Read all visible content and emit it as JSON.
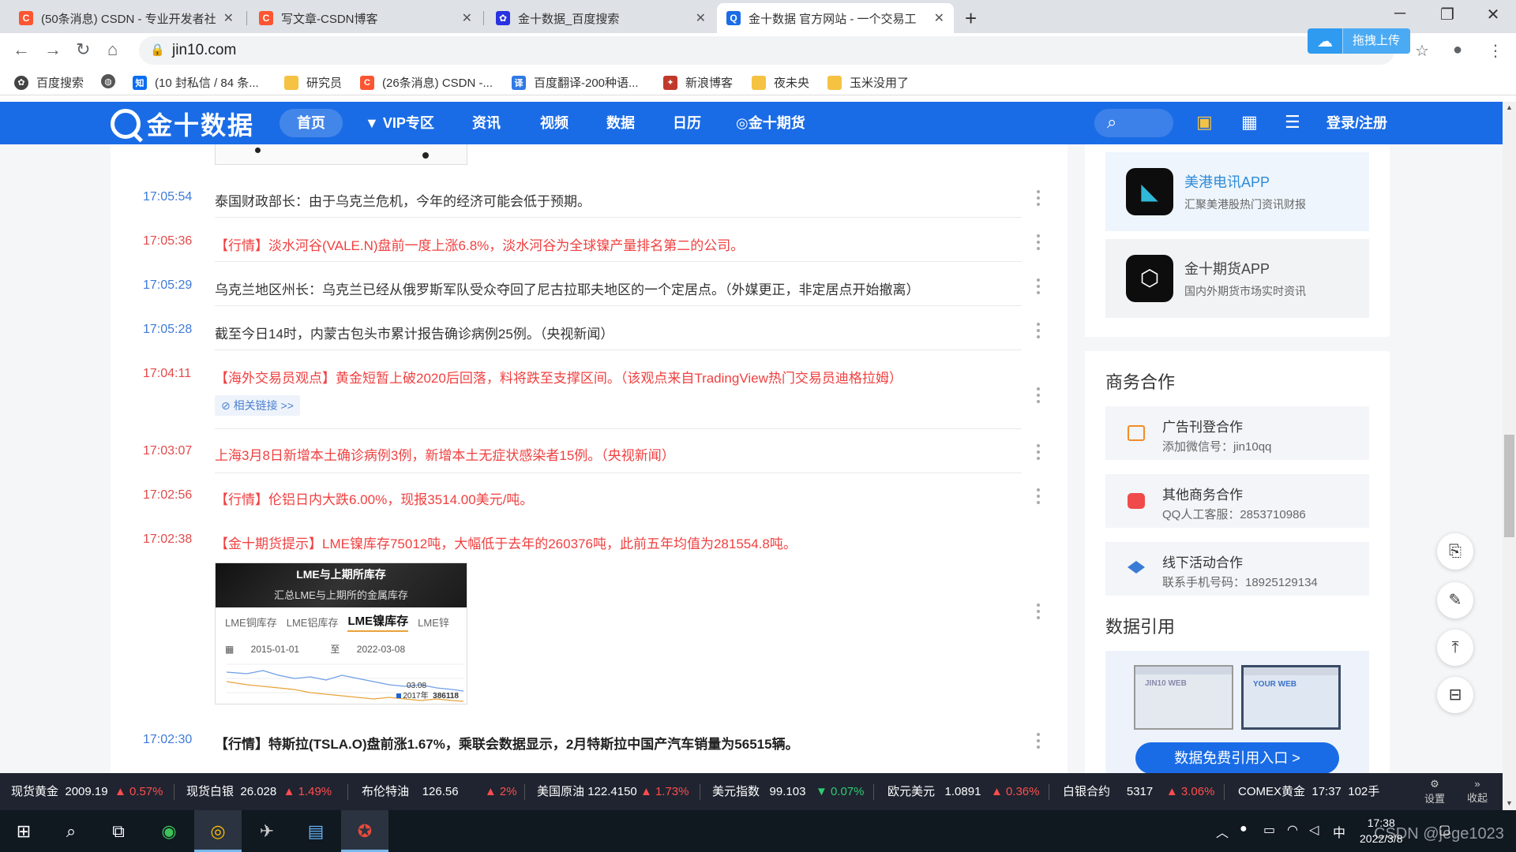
{
  "browser": {
    "tabs": [
      {
        "title": "(50条消息) CSDN - 专业开发者社",
        "icon": "csdn-icon",
        "color": "#fc5531"
      },
      {
        "title": "写文章-CSDN博客",
        "icon": "csdn-icon",
        "color": "#fc5531"
      },
      {
        "title": "金十数据_百度搜索",
        "icon": "baidu-paw-icon",
        "color": "#2932e1"
      },
      {
        "title": "金十数据 官方网站 - 一个交易工",
        "icon": "jin10-icon",
        "color": "#1a6ce6"
      }
    ],
    "url": "jin10.com",
    "upload_label": "拖拽上传",
    "bookmarks": [
      "百度搜索",
      "",
      "(10 封私信 / 84 条...",
      "研究员",
      "(26条消息) CSDN -...",
      "百度翻译-200种语...",
      "新浪博客",
      "夜未央",
      "玉米没用了"
    ]
  },
  "site": {
    "logo_text": "金十数据",
    "nav": [
      "首页",
      "VIP专区",
      "资讯",
      "视频",
      "数据",
      "日历",
      "金十期货"
    ],
    "login": "登录/注册"
  },
  "feed": [
    {
      "time": "17:05:54",
      "text": "泰国财政部长：由于乌克兰危机，今年的经济可能会低于预期。",
      "style": "normal"
    },
    {
      "time": "17:05:36",
      "text": "【行情】淡水河谷(VALE.N)盘前一度上涨6.8%，淡水河谷为全球镍产量排名第二的公司。",
      "style": "red"
    },
    {
      "time": "17:05:29",
      "text": "乌克兰地区州长：乌克兰已经从俄罗斯军队受众夺回了尼古拉耶夫地区的一个定居点。（外媒更正，非定居点开始撤离）",
      "style": "normal"
    },
    {
      "time": "17:05:28",
      "text": "截至今日14时，内蒙古包头市累计报告确诊病例25例。（央视新闻）",
      "style": "normal"
    },
    {
      "time": "17:04:11",
      "text": "【海外交易员观点】黄金短暂上破2020后回落，料将跌至支撑区间。（该观点来自TradingView热门交易员迪格拉姆）",
      "style": "red"
    },
    {
      "time": "17:03:07",
      "text": "上海3月8日新增本土确诊病例3例，新增本土无症状感染者15例。（央视新闻）",
      "style": "red"
    },
    {
      "time": "17:02:56",
      "text": "【行情】伦铝日内大跌6.00%，现报3514.00美元/吨。",
      "style": "red"
    },
    {
      "time": "17:02:38",
      "text": "【金十期货提示】LME镍库存75012吨，大幅低于去年的260376吨，此前五年均值为281554.8吨。",
      "style": "red"
    },
    {
      "time": "17:02:30",
      "text": "【行情】特斯拉(TSLA.O)盘前涨1.67%，乘联会数据显示，2月特斯拉中国产汽车销量为56515辆。",
      "style": "bold"
    }
  ],
  "related_link": "相关链接 >>",
  "lme_card": {
    "title": "LME与上期所库存",
    "subtitle": "汇总LME与上期所的金属库存",
    "tabs": [
      "LME铜库存",
      "LME铝库存",
      "LME镍库存",
      "LME锌"
    ],
    "date_from": "2015-01-01",
    "to_label": "至",
    "date_to": "2022-03-08",
    "marker_date": "03.08",
    "legend": "2017年",
    "value": "386118"
  },
  "right": {
    "apps": [
      {
        "name": "美港电讯APP",
        "desc": "汇聚美港股热门资讯财报"
      },
      {
        "name": "金十期货APP",
        "desc": "国内外期货市场实时资讯"
      }
    ],
    "biz_title": "商务合作",
    "biz": [
      {
        "title": "广告刊登合作",
        "desc": "添加微信号：jin10qq",
        "color": "#f28c28"
      },
      {
        "title": "其他商务合作",
        "desc": "QQ人工客服：2853710986",
        "color": "#f04a4a"
      },
      {
        "title": "线下活动合作",
        "desc": "联系手机号码：18925129134",
        "color": "#3a7bd5"
      }
    ],
    "data_title": "数据引用",
    "screen_a": "JIN10 WEB",
    "screen_b": "YOUR WEB",
    "data_btn": "数据免费引用入口 >"
  },
  "ticker": [
    {
      "name": "现货黄金",
      "price": "2009.19",
      "chg": "▲ 0.57%",
      "dir": "up"
    },
    {
      "name": "现货白银",
      "price": "26.028",
      "chg": "▲ 1.49%",
      "dir": "up"
    },
    {
      "name": "布伦特油",
      "price": "126.56",
      "chg": "▲ 2%",
      "dir": "up"
    },
    {
      "name": "美国原油",
      "price": "122.4150",
      "chg": "▲ 1.73%",
      "dir": "up"
    },
    {
      "name": "美元指数",
      "price": "99.103",
      "chg": "▼ 0.07%",
      "dir": "dn"
    },
    {
      "name": "欧元美元",
      "price": "1.0891",
      "chg": "▲ 0.36%",
      "dir": "up"
    },
    {
      "name": "白银合约",
      "price": "5317",
      "chg": "▲ 3.06%",
      "dir": "up"
    },
    {
      "name": "COMEX黄金",
      "price": "17:37",
      "chg": "102手",
      "dir": "none"
    }
  ],
  "ticker_side": {
    "settings": "设置",
    "collapse": "收起"
  },
  "taskbar": {
    "ime": "中",
    "time": "17:38",
    "date": "2022/3/8",
    "watermark": "CSDN @jege1023"
  }
}
